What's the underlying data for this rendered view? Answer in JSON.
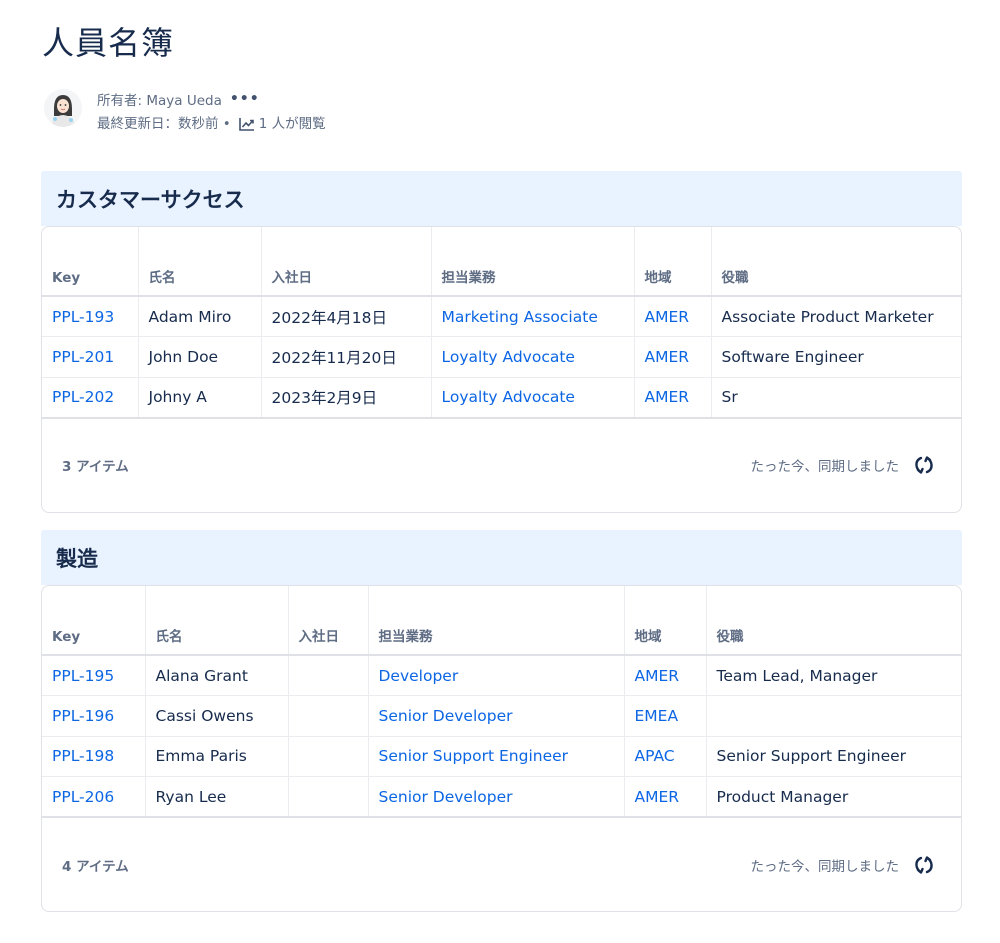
{
  "page": {
    "title": "人員名簿",
    "owner": "所有者: Maya Ueda",
    "more_icon": "more-icon",
    "last_updated": "最終更新日：数秒前 •",
    "views": "1 人が閲覧"
  },
  "columns": {
    "key": "Key",
    "name": "氏名",
    "start": "入社日",
    "duty": "担当業務",
    "region": "地域",
    "position": "役職"
  },
  "sections": [
    {
      "title": "カスタマーサクセス",
      "rows": [
        {
          "key": "PPL-193",
          "name": "Adam Miro",
          "start": "2022年4月18日",
          "duty": "Marketing Associate",
          "region": "AMER",
          "position": "Associate Product Marketer"
        },
        {
          "key": "PPL-201",
          "name": "John Doe",
          "start": "2022年11月20日",
          "duty": "Loyalty Advocate",
          "region": "AMER",
          "position": "Software Engineer"
        },
        {
          "key": "PPL-202",
          "name": "Johny A",
          "start": "2023年2月9日",
          "duty": "Loyalty Advocate",
          "region": "AMER",
          "position": "Sr"
        }
      ],
      "count": "3 アイテム",
      "sync": "たった今、同期しました"
    },
    {
      "title": "製造",
      "rows": [
        {
          "key": "PPL-195",
          "name": "Alana Grant",
          "start": "",
          "duty": "Developer",
          "region": "AMER",
          "position": "Team Lead, Manager"
        },
        {
          "key": "PPL-196",
          "name": "Cassi Owens",
          "start": "",
          "duty": "Senior Developer",
          "region": "EMEA",
          "position": ""
        },
        {
          "key": "PPL-198",
          "name": "Emma Paris",
          "start": "",
          "duty": "Senior Support Engineer",
          "region": "APAC",
          "position": "Senior Support Engineer"
        },
        {
          "key": "PPL-206",
          "name": "Ryan Lee",
          "start": "",
          "duty": "Senior Developer",
          "region": "AMER",
          "position": "Product Manager"
        }
      ],
      "count": "4 アイテム",
      "sync": "たった今、同期しました"
    }
  ],
  "colors": {
    "link": "#0c66e4",
    "header_bg": "#e9f2ff",
    "text": "#172b4d",
    "muted": "#5e6c84"
  }
}
